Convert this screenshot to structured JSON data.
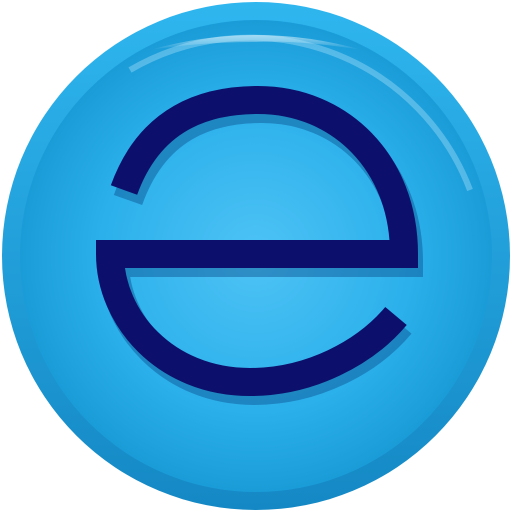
{
  "icon": {
    "name": "letter-e-button-icon",
    "glyph": "e",
    "colors": {
      "outer_ring": "#1b9ad6",
      "disc_light": "#4ec3f5",
      "disc_mid": "#2bb0eb",
      "disc_dark": "#1596d2",
      "highlight": "#bfeafe",
      "glyph": "#0c0f6b",
      "glyph_shadow": "#0a4f8f"
    }
  }
}
